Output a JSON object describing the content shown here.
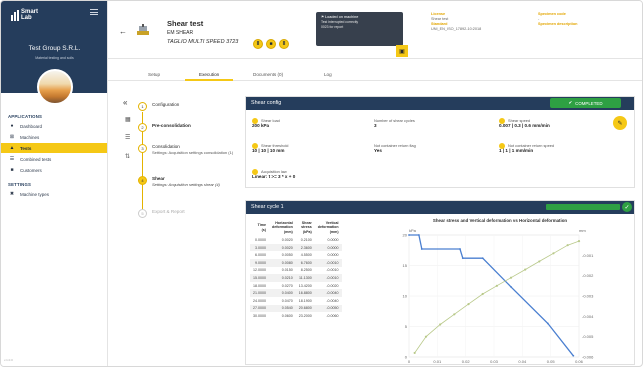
{
  "brand": {
    "logo_line1": "Smart",
    "logo_line2": "Lab",
    "company": "Test Group S.R.L.",
    "tagline": "Material testing and soils"
  },
  "sidebar": {
    "section_applications": "APPLICATIONS",
    "items": [
      {
        "label": "Dashboard",
        "icon": "gauge-icon"
      },
      {
        "label": "Machines",
        "icon": "machine-icon"
      },
      {
        "label": "Tests",
        "icon": "flask-icon",
        "active": true
      },
      {
        "label": "Combined tests",
        "icon": "layers-icon"
      },
      {
        "label": "Customers",
        "icon": "users-icon"
      }
    ],
    "section_settings": "SETTINGS",
    "settings_items": [
      {
        "label": "Machine types",
        "icon": "machine-type-icon"
      }
    ],
    "version": "v.1.0.0"
  },
  "header": {
    "title": "Shear test",
    "sub1": "EM SHEAR",
    "sub2": "TAGLIO MULTI SPEED 3723",
    "tooltip_title": "Loaded on machine",
    "tooltip_line1": "Test interrupted correctly",
    "tooltip_line2": "0023 for report",
    "license_label": "License",
    "license_value": "Shear test",
    "standard_label": "Standard",
    "standard_value": "UNI_EN_ISO_17892-10:2018",
    "specimen_code_label": "Specimen code",
    "specimen_code_value": "-",
    "specimen_desc_label": "Specimen description"
  },
  "tabs": [
    "Setup",
    "Execution",
    "Documents (0)",
    "Log"
  ],
  "active_tab": "Execution",
  "steps": [
    {
      "n": "1",
      "title": "Configuration",
      "sub": ""
    },
    {
      "n": "2",
      "title": "Pre-consolidation",
      "sub": ""
    },
    {
      "n": "3",
      "title": "Consolidation",
      "sub": "Settings: Acquisition settings consolidation (1)"
    },
    {
      "n": "4",
      "title": "Shear",
      "sub": "Settings: Acquisition settings shear (4)"
    },
    {
      "n": "5",
      "title": "Export & Report",
      "sub": ""
    }
  ],
  "shear_config": {
    "title": "Shear config",
    "status": "COMPLETED",
    "fields": [
      {
        "label": "Shear load",
        "value": "200 kPa"
      },
      {
        "label": "Number of shear cycles",
        "value": "3"
      },
      {
        "label": "Shear speed",
        "value": "0.007 | 0.3 | 0.6 mm/min"
      },
      {
        "label": "Shear threshold",
        "value": "10 | 10 | 10 mm"
      },
      {
        "label": "Not container return flag",
        "value": "Yes"
      },
      {
        "label": "Not container return speed",
        "value": "1 | 1 | 1 mm/min"
      },
      {
        "label": "Acquisition law",
        "value": "Linear: t >= 3 * x + 0"
      }
    ]
  },
  "cycle": {
    "title": "Shear cycle 1",
    "progress": 1.0,
    "table": {
      "headers": [
        [
          "Time",
          "(s)"
        ],
        [
          "Horizontal",
          "deformation",
          "(mm)"
        ],
        [
          "Shear",
          "stress",
          "(kPa)"
        ],
        [
          "Vertical",
          "deformation",
          "(mm)"
        ]
      ],
      "rows": [
        [
          "0.0000",
          "0.0020",
          "0.2100",
          "0.0000"
        ],
        [
          "3.0000",
          "0.0020",
          "2.3600",
          "0.0000"
        ],
        [
          "6.0000",
          "0.0050",
          "4.5500",
          "0.0000"
        ],
        [
          "9.0000",
          "0.0080",
          "6.7600",
          "-0.0010"
        ],
        [
          "12.0000",
          "0.0150",
          "8.2500",
          "-0.0010"
        ],
        [
          "15.0000",
          "0.0210",
          "11.1300",
          "-0.0010"
        ],
        [
          "18.0000",
          "0.0270",
          "13.4200",
          "-0.0020"
        ],
        [
          "21.0000",
          "0.0400",
          "16.8800",
          "-0.0040"
        ],
        [
          "24.0000",
          "0.0470",
          "18.1900",
          "-0.0040"
        ],
        [
          "27.0000",
          "0.0540",
          "20.6800",
          "-0.0050"
        ],
        [
          "30.0000",
          "0.0600",
          "23.2000",
          "-0.0060"
        ]
      ]
    }
  },
  "chart_data": {
    "type": "line",
    "title": "Shear stress and Vertical deformation vs Horizontal deformation",
    "y1_unit": "kPa",
    "y2_unit": "mm",
    "xlim": [
      0,
      0.06
    ],
    "y1lim": [
      0,
      20
    ],
    "y2lim": [
      -0.006,
      0
    ],
    "x_ticks": [
      "0",
      "0.01",
      "0.02",
      "0.03",
      "0.04",
      "0.05",
      "0.06"
    ],
    "y1_ticks": [
      "0",
      "5",
      "10",
      "15",
      "20"
    ],
    "y2_ticks": [
      "-0.001",
      "-0.002",
      "-0.003",
      "-0.004",
      "-0.005",
      "-0.006"
    ],
    "colors": {
      "stress": "#4a7fd0",
      "vertical": "#b9c98a"
    },
    "series": [
      {
        "axis": "y1",
        "color": "stress",
        "x": [
          0.0,
          0.0035,
          0.0045,
          0.018,
          0.019,
          0.026,
          0.036,
          0.049,
          0.058
        ],
        "y": [
          20.0,
          20.0,
          17.7,
          17.7,
          16.2,
          16.2,
          11.5,
          5.5,
          0.2
        ]
      },
      {
        "axis": "y2",
        "color": "vertical",
        "x": [
          0.002,
          0.006,
          0.011,
          0.016,
          0.021,
          0.026,
          0.031,
          0.036,
          0.041,
          0.046,
          0.051,
          0.056,
          0.06
        ],
        "y": [
          -0.0058,
          -0.005,
          -0.0044,
          -0.0039,
          -0.0034,
          -0.0029,
          -0.0025,
          -0.0021,
          -0.0017,
          -0.0013,
          -0.0009,
          -0.0005,
          -0.0003
        ]
      }
    ]
  }
}
